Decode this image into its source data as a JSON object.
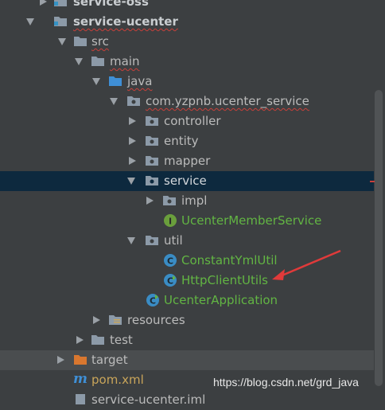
{
  "tree": {
    "items": [
      {
        "label": "service-oss"
      },
      {
        "label": "service-ucenter"
      },
      {
        "label": "src"
      },
      {
        "label": "main"
      },
      {
        "label": "java"
      },
      {
        "label": "com.yzpnb.ucenter_service"
      },
      {
        "label": "controller"
      },
      {
        "label": "entity"
      },
      {
        "label": "mapper"
      },
      {
        "label": "service"
      },
      {
        "label": "impl"
      },
      {
        "label": "UcenterMemberService"
      },
      {
        "label": "util"
      },
      {
        "label": "ConstantYmlUtil"
      },
      {
        "label": "HttpClientUtils"
      },
      {
        "label": "UcenterApplication"
      },
      {
        "label": "resources"
      },
      {
        "label": "test"
      },
      {
        "label": "target"
      },
      {
        "label": "pom.xml"
      },
      {
        "label": "service-ucenter.iml"
      }
    ]
  },
  "colors": {
    "accent_green": "#62b543",
    "selection": "#0d293e",
    "annotation_red": "#e03a3a"
  },
  "watermark": "https://blog.csdn.net/grd_java"
}
